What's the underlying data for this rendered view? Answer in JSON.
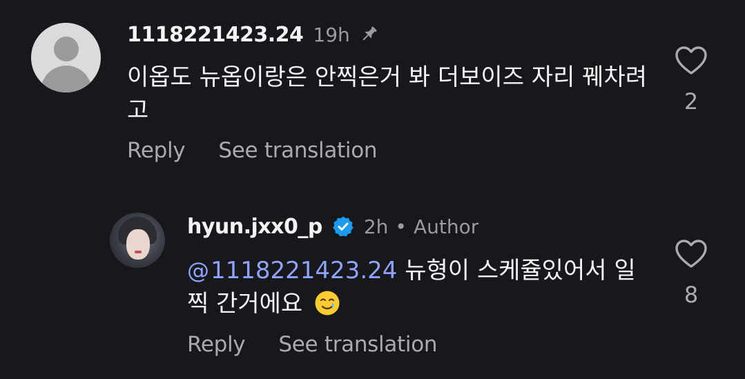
{
  "comments": [
    {
      "username": "1118221423.24",
      "time": "19h",
      "pinned": true,
      "text": "이옵도 뉴옵이랑은 안찍은거 봐 더보이즈 자리 꿰차려고",
      "reply_label": "Reply",
      "translate_label": "See translation",
      "likes": "2"
    },
    {
      "username": "hyun.jxx0_p",
      "verified": true,
      "time": "2h",
      "separator": "•",
      "role": "Author",
      "mention": "1118221423.24",
      "text": " 뉴형이 스케쥴있어서 일찍 간거에요",
      "emoji": "smiling-face-with-tear",
      "reply_label": "Reply",
      "translate_label": "See translation",
      "likes": "8"
    }
  ],
  "colors": {
    "background": "#17181c",
    "text_primary": "#f5f5f5",
    "text_secondary": "#a9abb2",
    "mention": "#8fa3ff",
    "verified": "#1d9bf0"
  }
}
